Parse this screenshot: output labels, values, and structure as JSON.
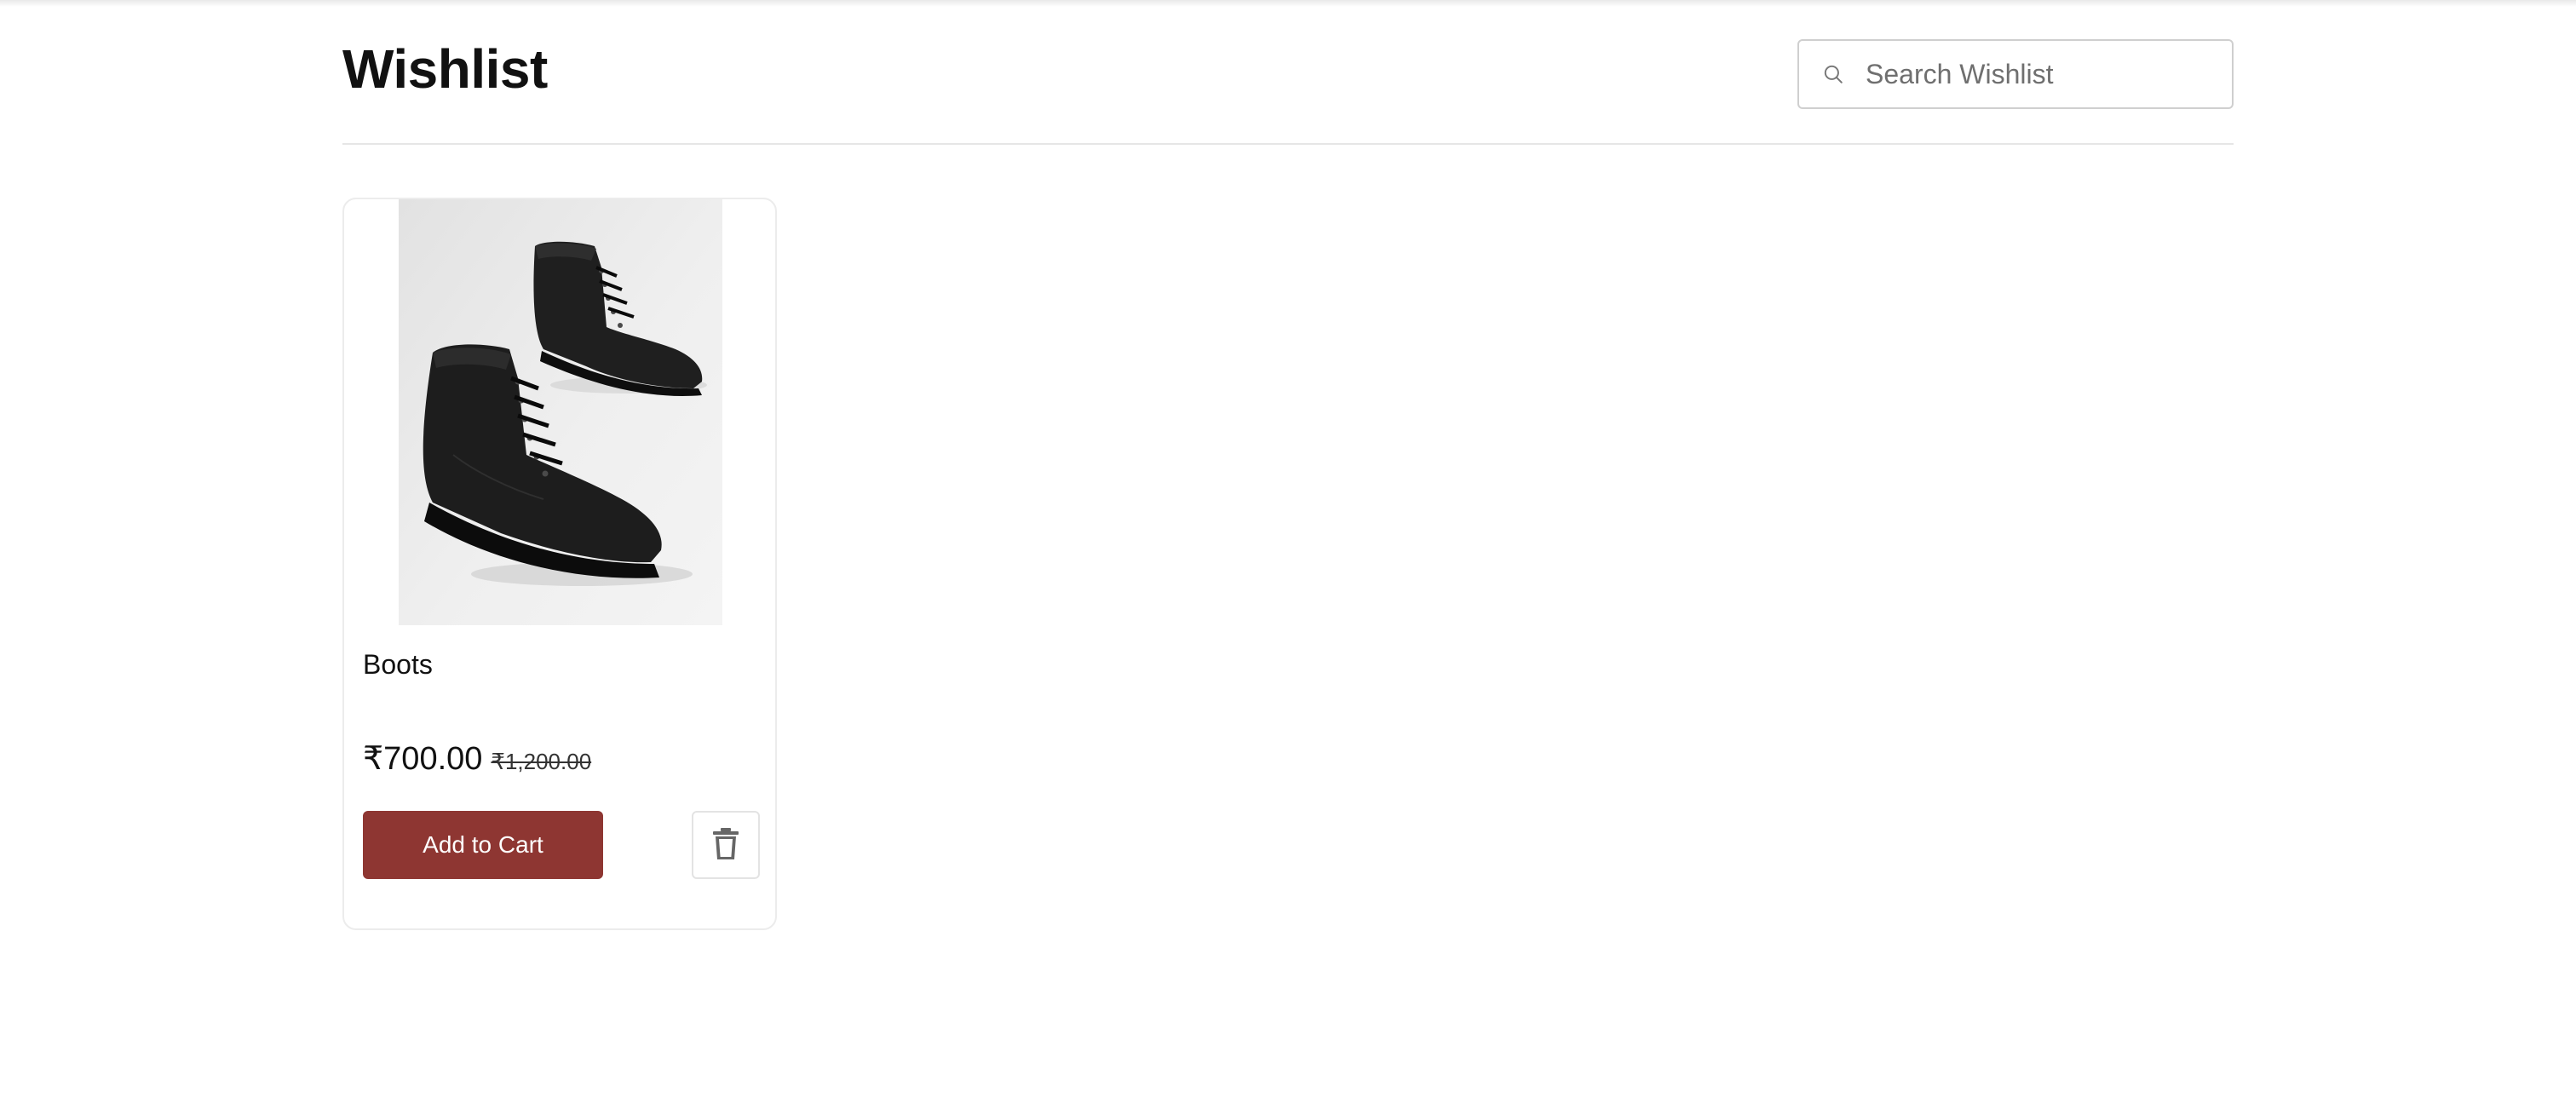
{
  "page": {
    "title": "Wishlist"
  },
  "search": {
    "placeholder": "Search Wishlist",
    "value": "",
    "icon": "search-icon"
  },
  "wishlist": {
    "items": [
      {
        "name": "Boots",
        "image_icon": "boots-image",
        "price": "₹700.00",
        "original_price": "₹1,200.00",
        "add_to_cart_label": "Add to Cart",
        "delete_icon": "trash-icon"
      }
    ]
  },
  "colors": {
    "accent": "#8e3632",
    "border": "#e6e6e6",
    "text": "#111111"
  }
}
